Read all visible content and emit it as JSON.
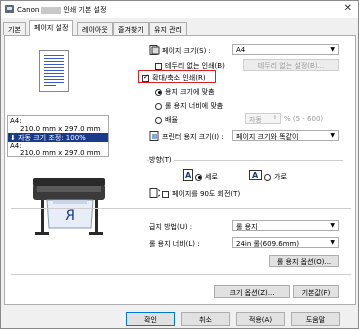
{
  "window": {
    "title_prefix": "Canon",
    "title_suffix": "인쇄 기본 설정",
    "close": "✕"
  },
  "tabs": [
    {
      "label": "기본"
    },
    {
      "label": "페이지 설정"
    },
    {
      "label": "레이아웃"
    },
    {
      "label": "즐겨찾기"
    },
    {
      "label": "유지 관리"
    }
  ],
  "preview": {
    "paper_header": "A4:",
    "paper_size": "210.0 mm x 297.0 mm",
    "auto_fit_label": "자동 크기 조정: 100%",
    "output_header": "A4:",
    "output_size": "210.0 mm x 297.0 mm",
    "banner_colors": {
      "selected": "#1a3a8a",
      "lines": "#3a5ad0"
    }
  },
  "page_size": {
    "label": "페이지 크기(S) :",
    "value": "A4"
  },
  "borderless": {
    "label": "테두리 없는 인쇄(B)",
    "settings_button": "테두리 없는 설정(B)..."
  },
  "enlarge": {
    "label": "확대/축소 인쇄(R)"
  },
  "fit_paper": {
    "label": "용지 크기에 맞춤"
  },
  "fit_width": {
    "label": "롤 용지 너비에 맞춤"
  },
  "scaling": {
    "label": "배율",
    "value": "자동",
    "unit": "% (5 - 600)"
  },
  "printer_paper": {
    "label": "프린터 용지 크기(I) :",
    "value": "페이지 크기와 똑같이"
  },
  "orientation": {
    "label": "방향(T)",
    "portrait": "세로",
    "landscape": "가로",
    "rotate_label": "페이지를 90도 회전(T)"
  },
  "paper_source": {
    "label": "급지 방법(U) :",
    "value": "롤 용지"
  },
  "roll_width": {
    "label": "롤 용지 너비(L) :",
    "value": "24in 롤(609.6mm)"
  },
  "roll_options_button": "롤 용지 옵션(O)...",
  "size_options_button": "크기 옵션(Z)...",
  "defaults_button": "기본값(F)",
  "footer": {
    "ok": "확인",
    "cancel": "취소",
    "apply": "적용(A)",
    "help": "도움말"
  }
}
